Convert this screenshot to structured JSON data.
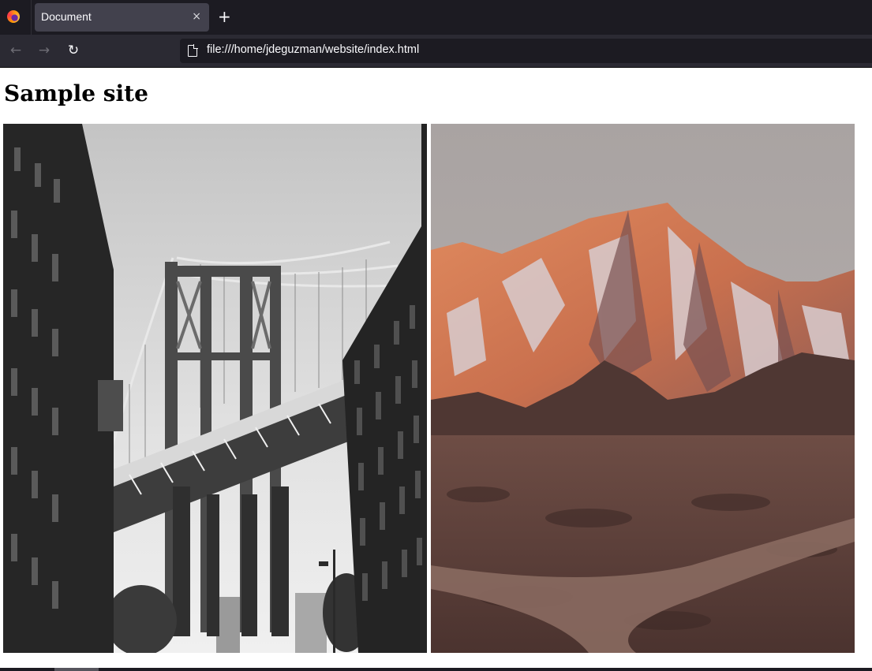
{
  "browser": {
    "tab_title": "Document",
    "tab_close": "×",
    "new_tab": "+",
    "url": "file:///home/jdeguzman/website/index.html",
    "nav": {
      "back": "←",
      "forward": "→",
      "reload": "↻"
    }
  },
  "page": {
    "heading": "Sample site",
    "images": [
      {
        "subject": "black-and-white bridge between brick buildings"
      },
      {
        "subject": "sunlit snowy mountain above desert scrub"
      }
    ]
  },
  "colors": {
    "chrome_dark": "#1c1b22",
    "chrome_toolbar": "#2b2a33",
    "tab_active": "#42414d",
    "text_light": "#fbfbfe"
  }
}
